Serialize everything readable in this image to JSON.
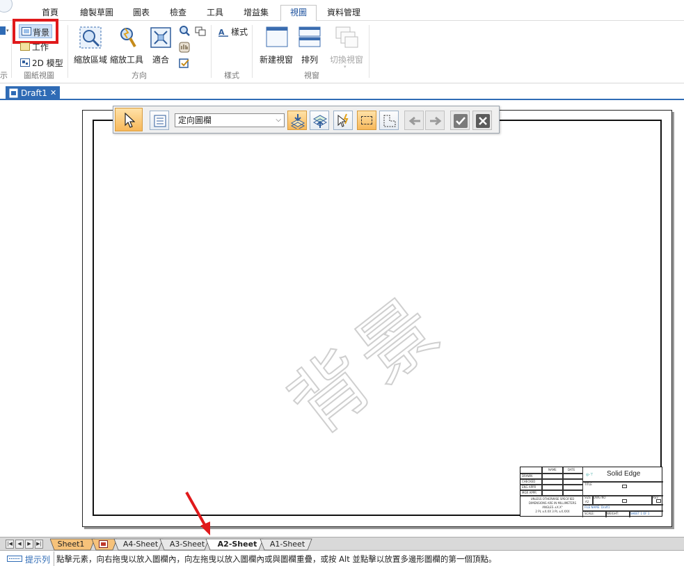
{
  "ribbon_tabs": [
    "首頁",
    "繪製草圖",
    "圖表",
    "檢查",
    "工具",
    "增益集",
    "視圖",
    "資料管理"
  ],
  "active_tab": "視圖",
  "ribbon": {
    "sheet_views": {
      "background": "背景",
      "working": "工作",
      "model_2d": "2D 模型",
      "group": "圖紙視圖",
      "prev_group_partial": "示"
    },
    "orient": {
      "zoom_area": "縮放區域",
      "zoom_tool": "縮放工具",
      "fit": "適合",
      "group": "方向"
    },
    "style": {
      "label": "樣式",
      "group": "樣式"
    },
    "window": {
      "new_window": "新建視窗",
      "arrange": "排列",
      "switch_window": "切換視窗",
      "group": "視窗"
    }
  },
  "document_tab": "Draft1",
  "floating_toolbar": {
    "dropdown_value": "定向圖欄"
  },
  "watermark": "背景",
  "title_block": {
    "logo_text": "Solid Edge",
    "rows": [
      "DRAWN",
      "CHECKED",
      "ENG APPR",
      "MGR APPR"
    ],
    "col_name": "NAME",
    "col_date": "DATE",
    "title": "TITLE",
    "notes": [
      "UNLESS OTHERWISE SPECIFIED",
      "DIMENSIONS ARE IN MILLIMETERS",
      "ANGLES ±X.X°",
      "2 PL ±X.XX 3 PL ±X.XXX"
    ],
    "size": "SIZE",
    "size_val": "A2",
    "dwg_no": "DWG NO",
    "rev": "REV",
    "file_name": "FILE NAME: Draft1",
    "scale": "SCALE:",
    "weight": "WEIGHT:",
    "sheet": "SHEET 1 OF 1"
  },
  "sheet_tabs": [
    "Sheet1",
    "A4-Sheet",
    "A3-Sheet",
    "A2-Sheet",
    "A1-Sheet"
  ],
  "active_sheet": "A2-Sheet",
  "status": {
    "label": "提示列",
    "message": "點擊元素，向右拖曳以放入圖欄內，向左拖曳以放入圖欄內或與圖欄重疊，或按 Alt 並點擊以放置多邊形圖欄的第一個頂點。"
  },
  "colors": {
    "highlight_red": "#e0191b",
    "accent_blue": "#2f6bb5",
    "sheet_tab_orange": "#f6c27a"
  }
}
